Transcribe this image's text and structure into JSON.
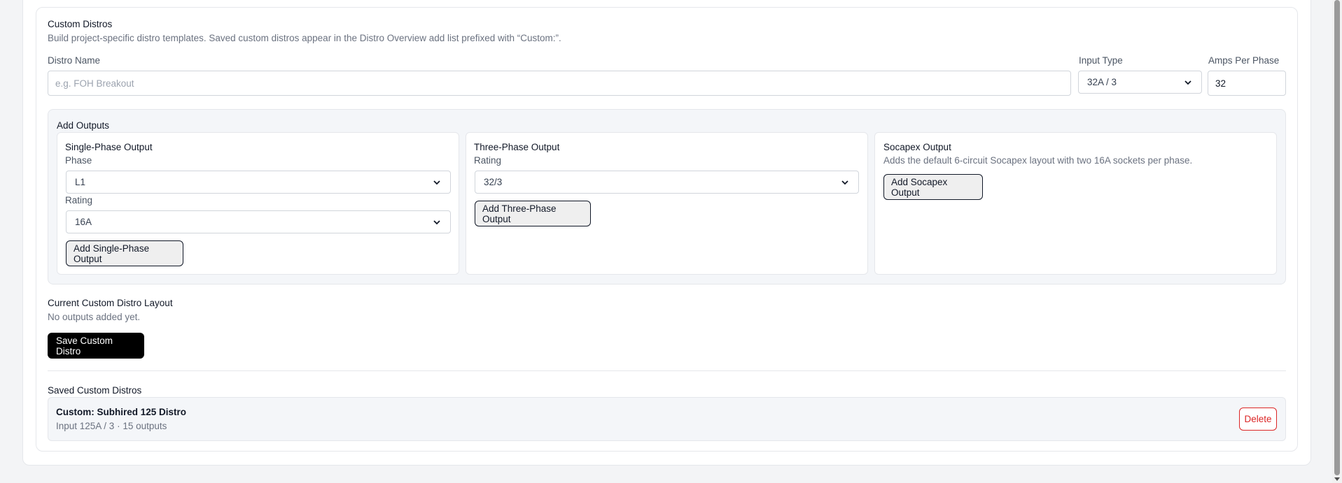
{
  "section": {
    "title": "Custom Distros",
    "description": "Build project-specific distro templates. Saved custom distros appear in the Distro Overview add list prefixed with “Custom:”."
  },
  "form": {
    "distro_name_label": "Distro Name",
    "distro_name_placeholder": "e.g. FOH Breakout",
    "distro_name_value": "",
    "input_type_label": "Input Type",
    "input_type_value": "32A / 3",
    "amps_per_phase_label": "Amps Per Phase",
    "amps_per_phase_value": "32"
  },
  "add_outputs": {
    "title": "Add Outputs",
    "single_phase": {
      "title": "Single-Phase Output",
      "phase_label": "Phase",
      "phase_value": "L1",
      "rating_label": "Rating",
      "rating_value": "16A",
      "button": "Add Single-Phase Output"
    },
    "three_phase": {
      "title": "Three-Phase Output",
      "rating_label": "Rating",
      "rating_value": "32/3",
      "button": "Add Three-Phase Output"
    },
    "socapex": {
      "title": "Socapex Output",
      "description": "Adds the default 6-circuit Socapex layout with two 16A sockets per phase.",
      "button": "Add Socapex Output"
    }
  },
  "current_layout": {
    "title": "Current Custom Distro Layout",
    "empty_text": "No outputs added yet.",
    "save_button": "Save Custom Distro"
  },
  "saved": {
    "title": "Saved Custom Distros",
    "items": [
      {
        "name": "Custom: Subhired 125 Distro",
        "details": "Input 125A / 3 · 15 outputs",
        "delete_label": "Delete"
      }
    ]
  },
  "colors": {
    "page_bg": "#f3f4f6",
    "panel_bg": "#f4f6f9",
    "primary_button": "#000000",
    "danger": "#dc2626",
    "muted_text": "#6b7280"
  }
}
